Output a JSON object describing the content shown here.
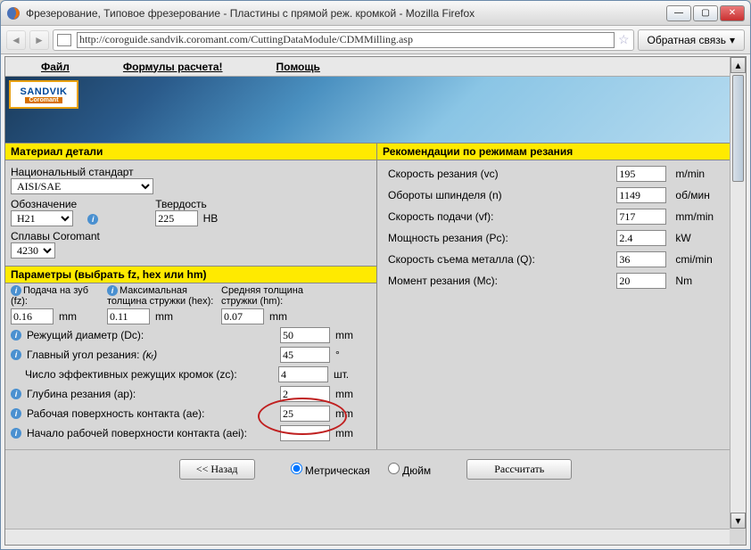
{
  "window": {
    "title": "Фрезерование, Типовое фрезерование - Пластины с прямой реж. кромкой - Mozilla Firefox",
    "url": "http://coroguide.sandvik.coromant.com/CuttingDataModule/CDMMilling.asp",
    "feedback": "Обратная связь"
  },
  "menu": {
    "file": "Файл",
    "formulas": "Формулы расчета!",
    "help": "Помощь"
  },
  "logo": {
    "top": "SANDVIK",
    "bot": "Coromant"
  },
  "material": {
    "header": "Материал детали",
    "std_label": "Национальный стандарт",
    "std_value": "AISI/SAE",
    "desig_label": "Обозначение",
    "desig_value": "H21",
    "hard_label": "Твердость",
    "hard_value": "225",
    "hard_unit": "HB",
    "alloy_label": "Сплавы Coromant",
    "alloy_value": "4230"
  },
  "params": {
    "header": "Параметры (выбрать fz, hex или hm)",
    "fz_label": "Подача на зуб (fz):",
    "fz_value": "0.16",
    "fz_unit": "mm",
    "hex_label": "Максимальная толщина стружки (hex):",
    "hex_value": "0.11",
    "hex_unit": "mm",
    "hm_label": "Средняя толщина стружки (hm):",
    "hm_value": "0.07",
    "hm_unit": "mm",
    "dc_label": "Режущий диаметр (Dc):",
    "dc_value": "50",
    "dc_unit": "mm",
    "angle_label": "Главный угол резания:",
    "angle_symbol": "(κᵣ)",
    "angle_value": "45",
    "angle_unit": "°",
    "zc_label": "Число эффективных режущих кромок (zc):",
    "zc_value": "4",
    "zc_unit": "шт.",
    "ap_label": "Глубина резания (aр):",
    "ap_value": "2",
    "ap_unit": "mm",
    "ae_label": "Рабочая поверхность контакта (ae):",
    "ae_value": "25",
    "ae_unit": "mm",
    "aei_label": "Начало рабочей поверхности контакта (aei):",
    "aei_value": "",
    "aei_unit": "mm"
  },
  "recommend": {
    "header": "Рекомендации по режимам резания",
    "vc_label": "Скорость резания (vc)",
    "vc_value": "195",
    "vc_unit": "m/min",
    "n_label": "Обороты шпинделя (n)",
    "n_value": "1149",
    "n_unit": "об/мин",
    "vf_label": "Скорость подачи (vf):",
    "vf_value": "717",
    "vf_unit": "mm/min",
    "pc_label": "Мощность резания (Pc):",
    "pc_value": "2.4",
    "pc_unit": "kW",
    "q_label": "Скорость съема металла (Q):",
    "q_value": "36",
    "q_unit": "cmi/min",
    "mc_label": "Момент резания (Mc):",
    "mc_value": "20",
    "mc_unit": "Nm"
  },
  "controls": {
    "back": "<< Назад",
    "metric": "Метрическая",
    "inch": "Дюйм",
    "calc": "Рассчитать"
  }
}
